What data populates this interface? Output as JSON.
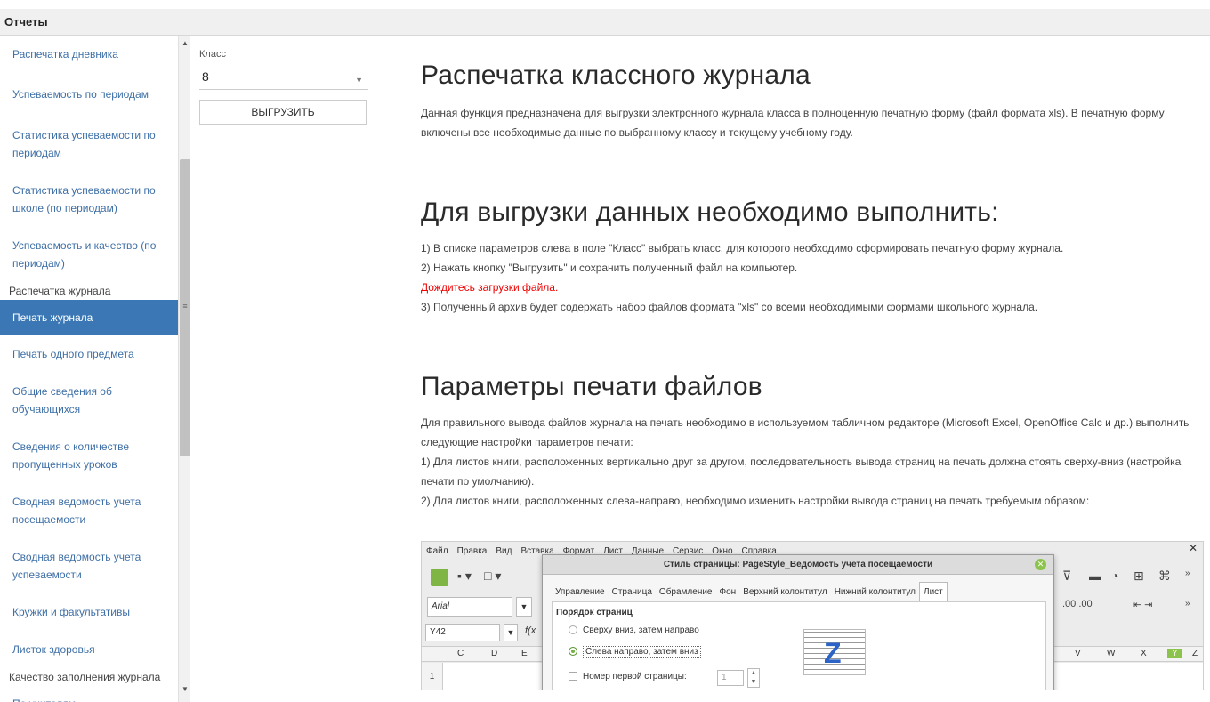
{
  "window": {
    "title": "Отчеты"
  },
  "sidebar": {
    "items": [
      {
        "type": "item",
        "label": "Распечатка дневника"
      },
      {
        "type": "item",
        "label": "Успеваемость по периодам"
      },
      {
        "type": "item",
        "label": "Статистика успеваемости по периодам"
      },
      {
        "type": "item",
        "label": "Статистика успеваемости по школе (по периодам)"
      },
      {
        "type": "item",
        "label": "Успеваемость и качество (по периодам)"
      },
      {
        "type": "group",
        "label": "Распечатка журнала"
      },
      {
        "type": "item",
        "label": "Печать журнала",
        "active": true
      },
      {
        "type": "item",
        "label": "Печать одного предмета"
      },
      {
        "type": "item",
        "label": "Общие сведения об обучающихся"
      },
      {
        "type": "item",
        "label": "Сведения о количестве пропущенных уроков"
      },
      {
        "type": "item",
        "label": "Сводная ведомость учета посещаемости"
      },
      {
        "type": "item",
        "label": "Сводная ведомость учета успеваемости"
      },
      {
        "type": "item",
        "label": "Кружки и факультативы"
      },
      {
        "type": "item",
        "label": "Листок здоровья"
      },
      {
        "type": "group",
        "label": "Качество заполнения журнала"
      },
      {
        "type": "item",
        "label": "По учителям"
      }
    ]
  },
  "params": {
    "class_label": "Класс",
    "class_value": "8",
    "export_button": "ВЫГРУЗИТЬ"
  },
  "content": {
    "h1": "Распечатка классного журнала",
    "intro": "Данная функция предназначена для выгрузки электронного журнала класса в полноценную печатную форму (файл формата xls). В печатную форму включены все необходимые данные по выбранному классу и текущему учебному году.",
    "h2": "Для выгрузки данных необходимо выполнить:",
    "steps": [
      "1) В списке параметров слева в поле \"Класс\" выбрать класс, для которого необходимо сформировать печатную форму журнала.",
      "2) Нажать кнопку \"Выгрузить\" и сохранить полученный файл на компьютер."
    ],
    "wait_note": "Дождитесь загрузки файла.",
    "step3": "3) Полученный архив будет содержать набор файлов формата \"xls\" со всеми необходимыми формами школьного журнала.",
    "h3": "Параметры печати файлов",
    "print_intro": "Для правильного вывода файлов журнала на печать необходимо в используемом табличном редакторе (Microsoft Excel, OpenOffice Calc и др.) выполнить следующие настройки параметров печати:",
    "print_1": "1) Для листов книги, расположенных вертикально друг за другом, последовательность вывода страниц на печать должна стоять сверху-вниз (настройка печати по умолчанию).",
    "print_2": "2) Для листов книги, расположенных слева-направо, необходимо изменить настройки вывода страниц на печать требуемым образом:"
  },
  "embed": {
    "menu": [
      "Файл",
      "Правка",
      "Вид",
      "Вставка",
      "Формат",
      "Лист",
      "Данные",
      "Сервис",
      "Окно",
      "Справка"
    ],
    "font": "Arial",
    "namebox": "Y42",
    "fx": "f(x",
    "columns": [
      "C",
      "D",
      "E",
      "V",
      "W",
      "X",
      "Y",
      "Z"
    ],
    "row": "1",
    "dialog": {
      "title": "Стиль страницы: PageStyle_Ведомость учета посещаемости",
      "tabs": [
        "Управление",
        "Страница",
        "Обрамление",
        "Фон",
        "Верхний колонтитул",
        "Нижний колонтитул",
        "Лист"
      ],
      "section": "Порядок страниц",
      "radio1": "Сверху вниз, затем направо",
      "radio2": "Слева направо, затем вниз",
      "checkbox": "Номер первой страницы:",
      "spin_value": "1"
    }
  },
  "colors": {
    "accent": "#3b77b4",
    "link": "#3e6fa6",
    "warning": "#e00000"
  }
}
